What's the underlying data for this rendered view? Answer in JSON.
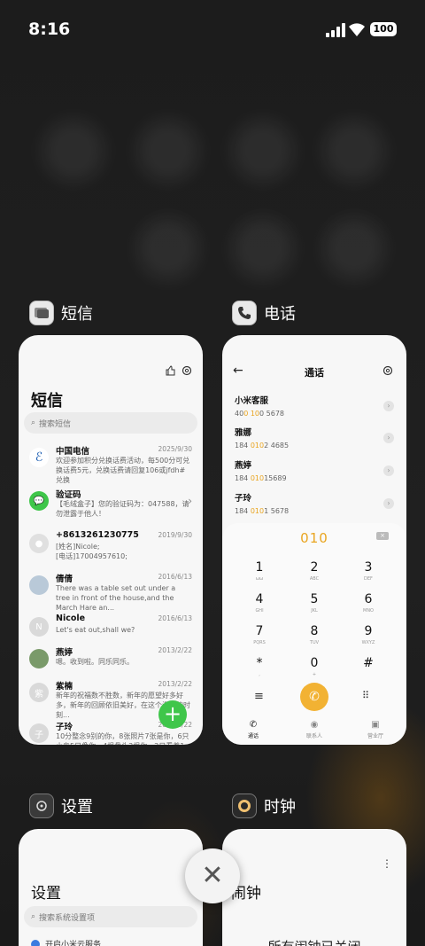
{
  "status_bar": {
    "time": "8:16",
    "battery": "100"
  },
  "apps": {
    "messages": {
      "name": "短信",
      "title": "短信",
      "search_placeholder": "搜索短信",
      "items": [
        {
          "name": "中国电信",
          "date": "2025/9/30",
          "text": "欢迎参加积分兑换话费活动，每500分可兑换话费5元，兑换话费请回复106或jfdh#兑换",
          "avatar": ""
        },
        {
          "name": "验证码",
          "date": "",
          "text": "【毛绒盒子】您的验证码为：047588，请勿泄露于他人！",
          "avatar": ""
        },
        {
          "name": "+8613261230775",
          "date": "2019/9/30",
          "text": "[姓名]Nicole;\n[电话]17004957610;",
          "avatar": ""
        },
        {
          "name": "倩倩",
          "date": "2016/6/13",
          "text": "There was a table set out under a tree in front of the house,and the March Hare an...",
          "avatar": ""
        },
        {
          "name": "Nicole",
          "date": "2016/6/13",
          "text": "Let's eat out,shall we?",
          "avatar": "N"
        },
        {
          "name": "燕婷",
          "date": "2013/2/22",
          "text": "嗯。收到啦。同乐同乐。",
          "avatar": ""
        },
        {
          "name": "紫楠",
          "date": "2013/2/22",
          "text": "新年的祝福数不胜数，新年的愿望好多好多，新年的回顾依旧美好，在这个温馨的时刻...",
          "avatar": "紫"
        },
        {
          "name": "子玲",
          "date": "2013/2/22",
          "text": "10分整念9别的你，8张照片7张是你，6只小鸟5只像你，4根骨头3根你，2只看着1只...",
          "avatar": "子"
        }
      ]
    },
    "phone": {
      "name": "电话",
      "title": "通话",
      "contacts": [
        {
          "name": "小米客服",
          "num_a": "40",
          "num_hl": "0 10",
          "num_b": "0 5678"
        },
        {
          "name": "雅娜",
          "num_a": "184 ",
          "num_hl": "010",
          "num_b": "2 4685"
        },
        {
          "name": "燕婷",
          "num_a": "184 ",
          "num_hl": "010",
          "num_b": "15689"
        },
        {
          "name": "子玲",
          "num_a": "184 ",
          "num_hl": "010",
          "num_b": "1 5678"
        }
      ],
      "dial_display": "010",
      "keys": [
        {
          "n": "1",
          "l": "ωω"
        },
        {
          "n": "2",
          "l": "ABC"
        },
        {
          "n": "3",
          "l": "DEF"
        },
        {
          "n": "4",
          "l": "GHI"
        },
        {
          "n": "5",
          "l": "JKL"
        },
        {
          "n": "6",
          "l": "MNO"
        },
        {
          "n": "7",
          "l": "PQRS"
        },
        {
          "n": "8",
          "l": "TUV"
        },
        {
          "n": "9",
          "l": "WXYZ"
        },
        {
          "n": "*",
          "l": ","
        },
        {
          "n": "0",
          "l": "+"
        },
        {
          "n": "#",
          "l": ""
        }
      ],
      "tabs": {
        "calls": "通话",
        "contacts": "联系人",
        "business": "营业厅"
      }
    },
    "settings": {
      "name": "设置",
      "title": "设置",
      "search_placeholder": "搜索系统设置项",
      "first_item": "开启小米云服务"
    },
    "clock": {
      "name": "时钟",
      "title": "闹钟",
      "empty_text": "所有闹钟已关闭"
    }
  }
}
